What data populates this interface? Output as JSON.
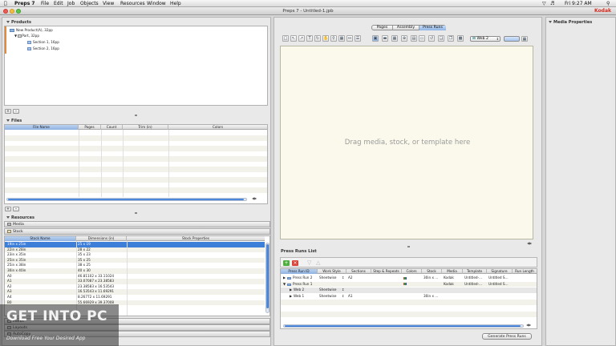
{
  "menubar": {
    "app_name": "Preps 7",
    "items": [
      "File",
      "Edit",
      "Job",
      "Objects",
      "View",
      "Resources",
      "Window",
      "Help"
    ],
    "clock": "Fri 9:27 AM"
  },
  "window": {
    "title": "Preps 7 - Untitled-1.jpb",
    "brand": "Kodak"
  },
  "products": {
    "header": "Products",
    "tree": [
      {
        "label": "New Product(A), 32pp"
      },
      {
        "label": "Part, 32pp"
      },
      {
        "label": "Section 1, 16pp"
      },
      {
        "label": "Section 2, 16pp"
      }
    ],
    "add_label": "+",
    "remove_label": "–"
  },
  "files": {
    "header": "Files",
    "columns": [
      "File Name",
      "Pages",
      "Count",
      "Trim (in)",
      "Colors"
    ],
    "add_label": "+",
    "remove_label": "–"
  },
  "resources": {
    "header": "Resources",
    "media_tab": "Media",
    "stock_tab": "Stock",
    "columns": [
      "Stock Name",
      "Dimensions (in)",
      "Stock Properties"
    ],
    "rows": [
      {
        "name": "19in x 25in",
        "dims": "25 x 19"
      },
      {
        "name": "22in x 28in",
        "dims": "28 x 22"
      },
      {
        "name": "23in x 35in",
        "dims": "35 x 23"
      },
      {
        "name": "25in x 35in",
        "dims": "35 x 25"
      },
      {
        "name": "25in x 38in",
        "dims": "38 x 25"
      },
      {
        "name": "30in x 40in",
        "dims": "40 x 30"
      },
      {
        "name": "A0",
        "dims": "46.81102 x 33.11024"
      },
      {
        "name": "A1",
        "dims": "33.07087 x 23.38583"
      },
      {
        "name": "A2",
        "dims": "23.38583 x 16.53543"
      },
      {
        "name": "A3",
        "dims": "16.53543 x 11.69291"
      },
      {
        "name": "A4",
        "dims": "8.26772 x 11.69291"
      },
      {
        "name": "B0",
        "dims": "55.66929 x 39.37008"
      }
    ],
    "bottom_tabs": [
      "Marks",
      "Layouts",
      "AutoCopy"
    ]
  },
  "center": {
    "view_tabs": [
      "Pages",
      "Assembly",
      "Press Runs"
    ],
    "web_select": "Web 2",
    "drop_hint": "Drag media, stock, or template here"
  },
  "pressruns": {
    "header": "Press Runs List",
    "columns": [
      "Press Run ID",
      "Work Style",
      "Sections",
      "Step & Repeats",
      "Colors",
      "Stock",
      "Media",
      "Template",
      "Signature",
      "Run Length"
    ],
    "rows": [
      {
        "id": "Press Run 2",
        "style": "Sheetwise",
        "sections": "A2",
        "stock": "30in x ...",
        "media": "Kodak",
        "template": "Untitled-...",
        "signature": "Untitled S..."
      },
      {
        "id": "Press Run 1",
        "style": "",
        "sections": "",
        "stock": "",
        "media": "Kodak",
        "template": "Untitled-...",
        "signature": "Untitled S..."
      },
      {
        "id": "Web 2",
        "style": "Sheetwise",
        "sections": "",
        "stock": "",
        "media": "",
        "template": "",
        "signature": ""
      },
      {
        "id": "Web 1",
        "style": "Sheetwise",
        "sections": "A1",
        "stock": "30in x ...",
        "media": "",
        "template": "",
        "signature": ""
      }
    ],
    "generate_button": "Generate Press Runs"
  },
  "media_properties": {
    "header": "Media Properties"
  },
  "watermark": {
    "title": "GET INTO PC",
    "subtitle": "Download Free Your Desired App"
  },
  "colors": {
    "accent": "#3d7ed9",
    "brand": "#d62a1e"
  }
}
